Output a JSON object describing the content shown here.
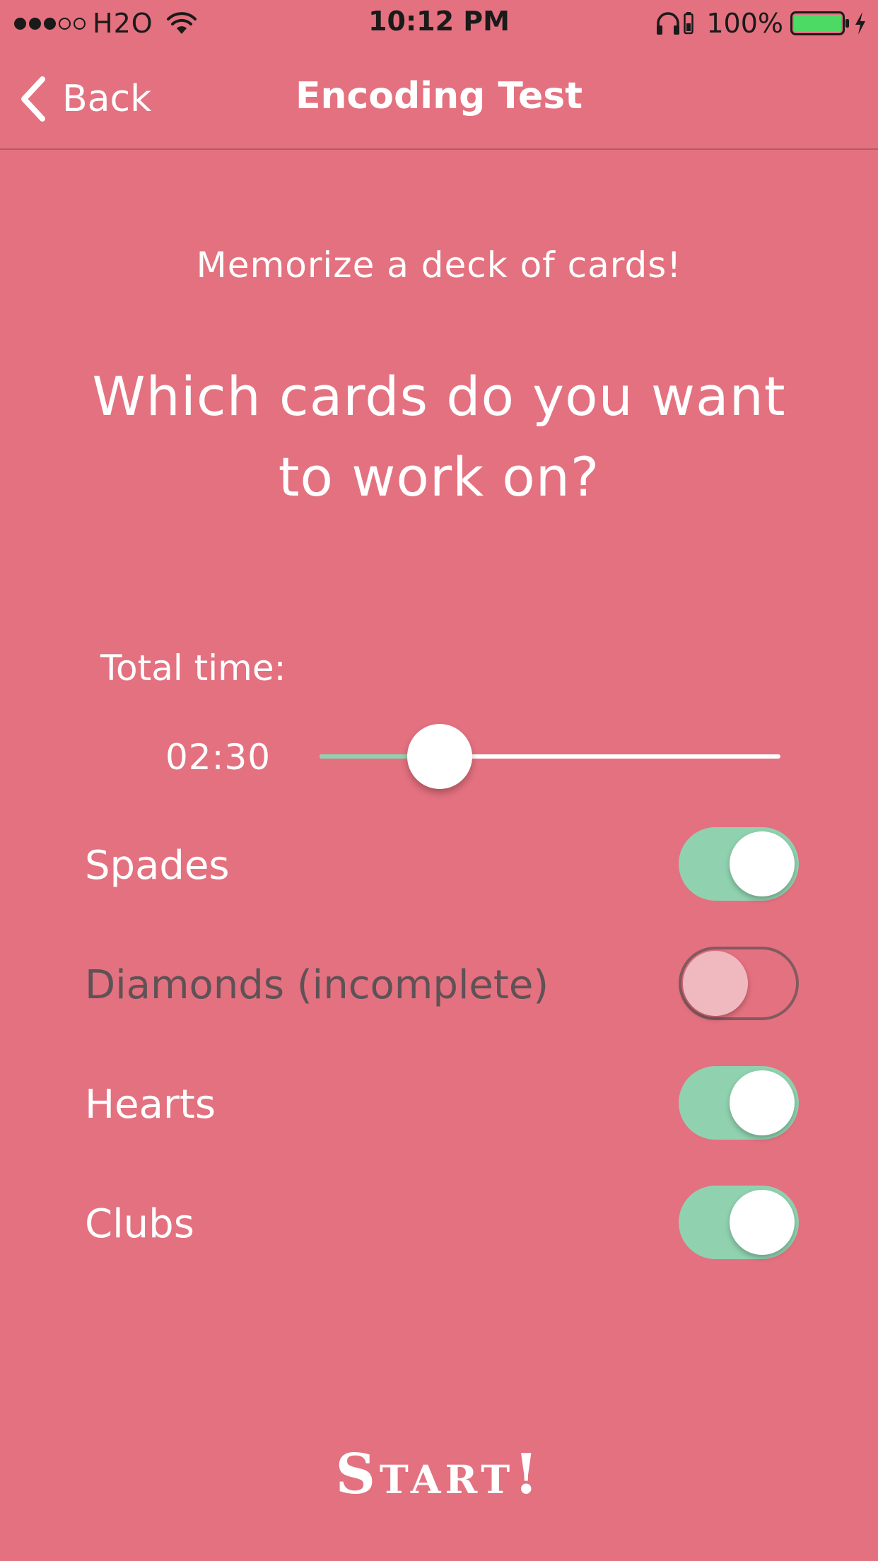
{
  "status_bar": {
    "carrier": "H2O",
    "time": "10:12 PM",
    "battery_percent": "100%",
    "signal_bars_filled": 3,
    "signal_bars_total": 5,
    "battery_level": 1.0,
    "battery_color": "#4cd964"
  },
  "nav": {
    "back_label": "Back",
    "title": "Encoding Test"
  },
  "content": {
    "subtitle": "Memorize a deck of cards!",
    "question": "Which cards do you want to work on?",
    "time_label": "Total time:",
    "time_value": "02:30",
    "slider_fraction": 0.26
  },
  "suits": [
    {
      "label": "Spades",
      "on": true,
      "enabled": true
    },
    {
      "label": "Diamonds (incomplete)",
      "on": false,
      "enabled": false
    },
    {
      "label": "Hearts",
      "on": true,
      "enabled": true
    },
    {
      "label": "Clubs",
      "on": true,
      "enabled": true
    }
  ],
  "start_label": "Start!",
  "colors": {
    "background": "#e4717f",
    "accent_green": "#90d2b0",
    "disabled_text": "#5e5256"
  }
}
